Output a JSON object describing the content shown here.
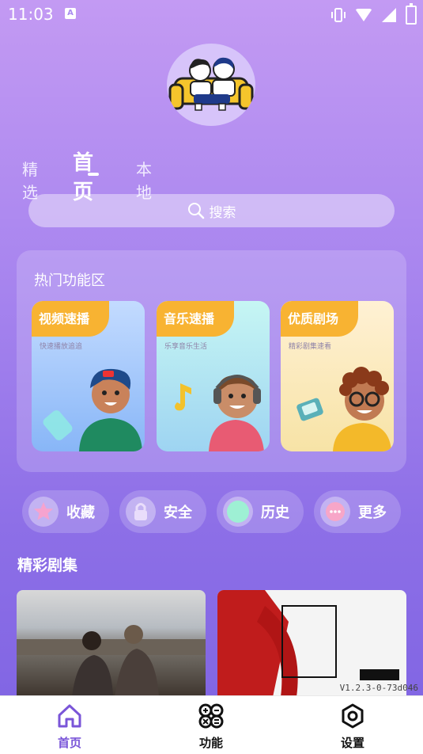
{
  "status_bar": {
    "time": "11:03",
    "notification_icon": "A"
  },
  "tabs": [
    {
      "label": "精选"
    },
    {
      "label": "首页"
    },
    {
      "label": "本地"
    }
  ],
  "search": {
    "placeholder": "搜索"
  },
  "hot_section": {
    "title": "热门功能区",
    "cards": [
      {
        "title": "视频速播",
        "subtitle": "快速播放追追"
      },
      {
        "title": "音乐速播",
        "subtitle": "乐享音乐生活"
      },
      {
        "title": "优质剧场",
        "subtitle": "精彩剧集速看"
      }
    ]
  },
  "quick_actions": [
    {
      "label": "收藏",
      "icon": "star-icon"
    },
    {
      "label": "安全",
      "icon": "lock-icon"
    },
    {
      "label": "历史",
      "icon": "history-icon"
    },
    {
      "label": "更多",
      "icon": "more-icon"
    }
  ],
  "drama_section": {
    "title": "精彩剧集"
  },
  "version": "V1.2.3-0-73d046",
  "bottom_nav": [
    {
      "label": "首页",
      "icon": "home-icon",
      "active": true
    },
    {
      "label": "功能",
      "icon": "function-icon",
      "active": false
    },
    {
      "label": "设置",
      "icon": "settings-icon",
      "active": false
    }
  ],
  "colors": {
    "accent": "#7a55d8",
    "tag": "#f8b332"
  }
}
